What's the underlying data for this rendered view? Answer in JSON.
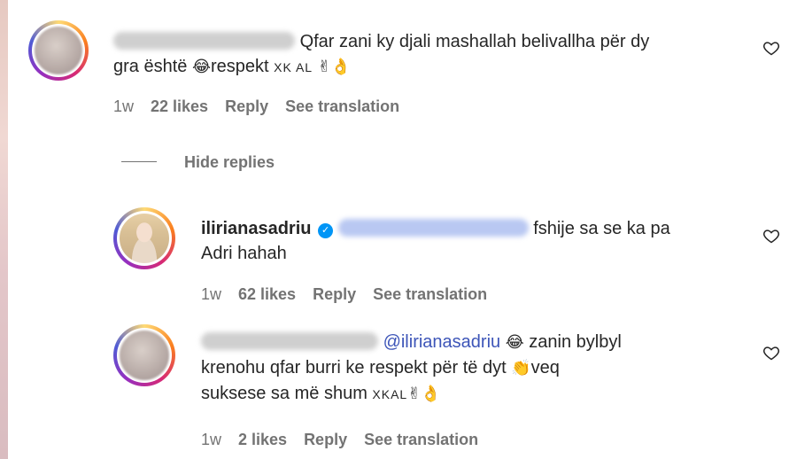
{
  "comments": [
    {
      "text_line1": "Qfar zani ky djali mashallah belivallha për dy",
      "text_line2_before": "gra është ",
      "emoji1": "😂",
      "text_line2_after": "respekt ",
      "smallcaps": "XK AL",
      "emoji2": "✌",
      "emoji3": "👌",
      "time": "1w",
      "likes": "22 likes",
      "reply": "Reply",
      "see_translation": "See translation"
    },
    {
      "username": "ilirianasadriu",
      "verified_icon": "✓",
      "text_line1": "fshije sa se ka pa",
      "text_line2": "Adri hahah",
      "time": "1w",
      "likes": "62 likes",
      "reply": "Reply",
      "see_translation": "See translation"
    },
    {
      "mention": "@ilirianasadriu",
      "emoji1": "😂",
      "text_line1_after": " zanin bylbyl",
      "text_line2": "krenohu qfar burri ke respekt për të dyt ",
      "emoji2": "👏",
      "text_line2_after": "veq",
      "text_line3": "suksese sa më shum ",
      "smallcaps": "XKAL",
      "emoji3": "✌",
      "emoji4": "👌",
      "time": "1w",
      "likes": "2 likes",
      "reply": "Reply",
      "see_translation": "See translation"
    }
  ],
  "hide_replies": "Hide replies",
  "icons": {
    "like": "heart-outline-icon",
    "verified": "verified-badge-icon"
  },
  "colors": {
    "text": "#262626",
    "meta": "#737373",
    "mention": "#3d55b8",
    "verified": "#0095f6"
  }
}
